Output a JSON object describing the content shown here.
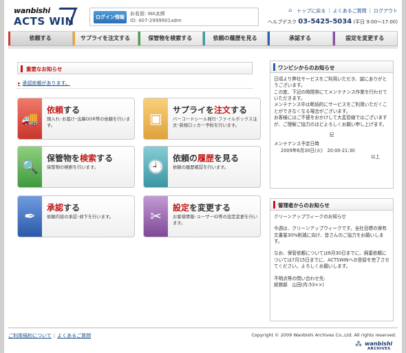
{
  "header": {
    "logo_line1": "wanbishi",
    "logo_line2": "ACTS WIN",
    "login_button": "ログイン情報",
    "user_name": "お名前: WA太郎",
    "user_id": "ID: 407-2999901adm",
    "links": [
      "トップに戻る",
      "よくあるご質問",
      "ログアウト"
    ],
    "help_desk_label": "ヘルプデスク",
    "help_desk_tel": "03-5425-5034",
    "help_desk_hours": "(平日 9:00〜17:00)"
  },
  "nav": {
    "items": [
      {
        "label": "依頼する",
        "color": "#d33a2c"
      },
      {
        "label": "サプライを注文する",
        "color": "#e9a82a"
      },
      {
        "label": "保管物を検索する",
        "color": "#4aa048"
      },
      {
        "label": "依頼の履歴を見る",
        "color": "#3c9aa6"
      },
      {
        "label": "承認する",
        "color": "#2b5fae"
      },
      {
        "label": "設定を変更する",
        "color": "#8b4ea0"
      }
    ]
  },
  "important": {
    "title": "重要なお知らせ",
    "link": "承認依頼があります。"
  },
  "cards": [
    {
      "title_pre": "",
      "title_em": "依頼",
      "title_post": "する",
      "desc": "預入れ･お届け･出庫DDR等の依頼を行います。",
      "color": "#d33a2c",
      "icon": "truck-icon",
      "glyph": "🚚"
    },
    {
      "title_pre": "サプライを",
      "title_em": "注文",
      "title_post": "する",
      "desc": "バーコードシール発行･ファイルボックス注文･新規ロッカー予約を行います。",
      "color": "#e9a82a",
      "icon": "box-icon",
      "glyph": "▣"
    },
    {
      "title_pre": "保管物を",
      "title_em": "検索",
      "title_post": "する",
      "desc": "保管物の検索を行います。",
      "color": "#4aa048",
      "icon": "search-folder-icon",
      "glyph": "🔍"
    },
    {
      "title_pre": "依頼の",
      "title_em": "履歴",
      "title_post": "を見る",
      "desc": "依頼の履歴確認を行います。",
      "color": "#3c9aa6",
      "icon": "history-document-icon",
      "glyph": "🕘"
    },
    {
      "title_pre": "",
      "title_em": "承認",
      "title_post": "する",
      "desc": "依頼内容の承認･却下を行います。",
      "color": "#2b5fae",
      "icon": "pen-icon",
      "glyph": "✒"
    },
    {
      "title_pre": "",
      "title_em": "設定",
      "title_post": "を変更する",
      "desc": "お客様情報･ユーザーID等の設定変更を行います。",
      "color": "#8b4ea0",
      "icon": "tools-icon",
      "glyph": "✂"
    }
  ],
  "wanbishi_notice": {
    "title": "ワンビシからのお知らせ",
    "lines": [
      "日頃より弊社サービスをご利用いただき、誠にありがとうございます。",
      "この度、下記の時間帯にてメンテナンス作業を行わせていただきます。",
      "メンテナンス中は断続的にサービスをご利用いただくことができなくなる場合がございます。",
      "お客様にはご不便をおかけして大変恐縮ではございますが、ご理解ご協力のほどよろしくお願い申し上げます。"
    ],
    "ki": "記",
    "schedule_label": "メンテナンス予定日時",
    "schedule": "2009年6月30日(火)　20:00-21:30",
    "ijo": "以上"
  },
  "admin_notice": {
    "title": "管理者からのお知らせ",
    "lines": [
      "クリーンアップウィークのお知らせ",
      "今週は、クリーンアップウィークです。全社目標の保有文書量30%削減に向け、皆さんのご協力をお願いします。",
      "なお、保管依頼については6月30日までに、廃棄依頼については7月15日までに、ACTSWINへの登録を完了させてください。よろしくお願いします。",
      "不明点等の問い合わせ先:",
      "総務部　山田(内:53××)"
    ]
  },
  "footer": {
    "links": [
      "ご利用規約について",
      "よくあるご質問"
    ],
    "copyright": "Copyright © 2009 Wanbishi Archives Co.,Ltd. All rights reserved.",
    "logo_line1": "wanbishi",
    "logo_line2": "ARCHIVES"
  }
}
